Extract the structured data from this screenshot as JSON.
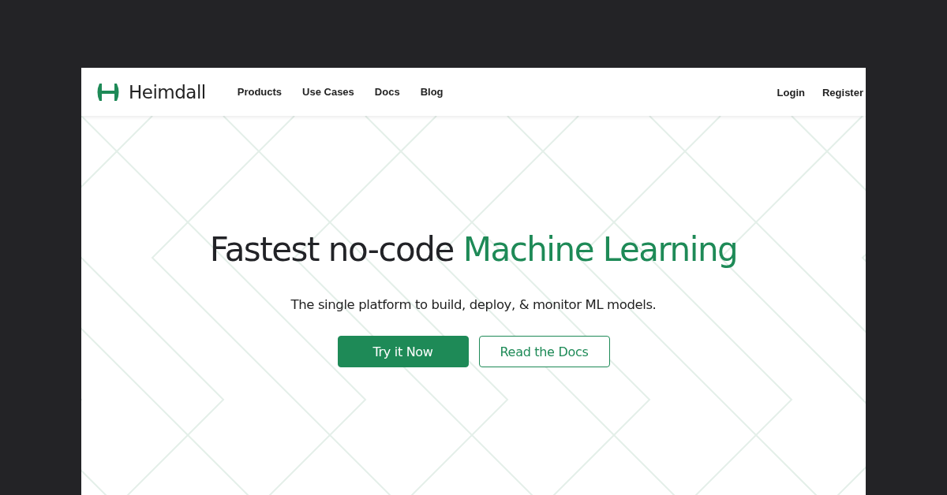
{
  "brand": {
    "name": "Heimdall"
  },
  "nav": {
    "links": [
      "Products",
      "Use Cases",
      "Docs",
      "Blog"
    ],
    "account": [
      "Login",
      "Register"
    ]
  },
  "hero": {
    "headline": "Fastest no-code ",
    "highlight": "Machine Learning",
    "subtitle": "The single platform to build, deploy, & monitor ML models.",
    "buttons": [
      {
        "label": "Try it Now",
        "kind": "primary"
      },
      {
        "label": "Read the Docs",
        "kind": "outline"
      }
    ]
  }
}
